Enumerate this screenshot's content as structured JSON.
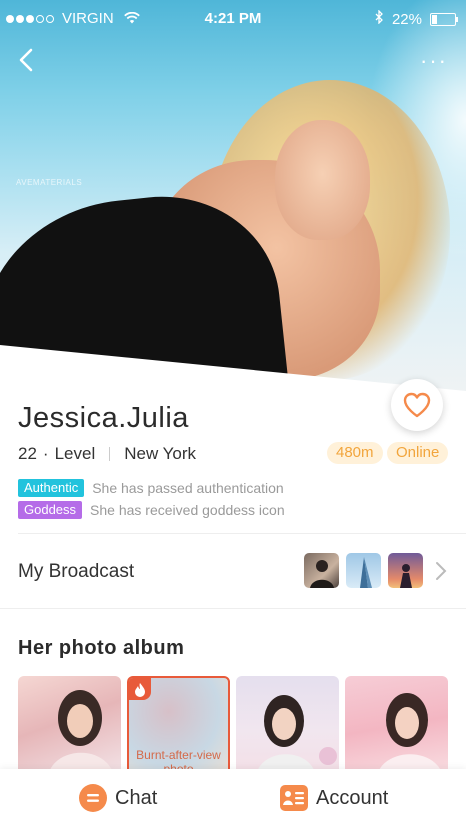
{
  "status_bar": {
    "carrier": "VIRGIN",
    "time": "4:21 PM",
    "battery": "22%"
  },
  "hero": {
    "watermark": "AVEMATERIALS"
  },
  "profile": {
    "name": "Jessica.Julia",
    "age": "22",
    "level_label": "Level",
    "location": "New York",
    "distance": "480m",
    "presence": "Online"
  },
  "badges": [
    {
      "label": "Authentic",
      "text": "She has passed authentication",
      "color": "#22c3dd"
    },
    {
      "label": "Goddess",
      "text": "She has received goddess icon",
      "color": "#b56ce8"
    }
  ],
  "broadcast": {
    "label": "My Broadcast"
  },
  "album": {
    "title": "Her photo album",
    "burnt_label": "Burnt-after-view photo"
  },
  "tabbar": {
    "chat": "Chat",
    "account": "Account"
  },
  "colors": {
    "accent": "#f58a4b",
    "pill_bg": "#fff1d9",
    "pill_text": "#f2a53c"
  }
}
